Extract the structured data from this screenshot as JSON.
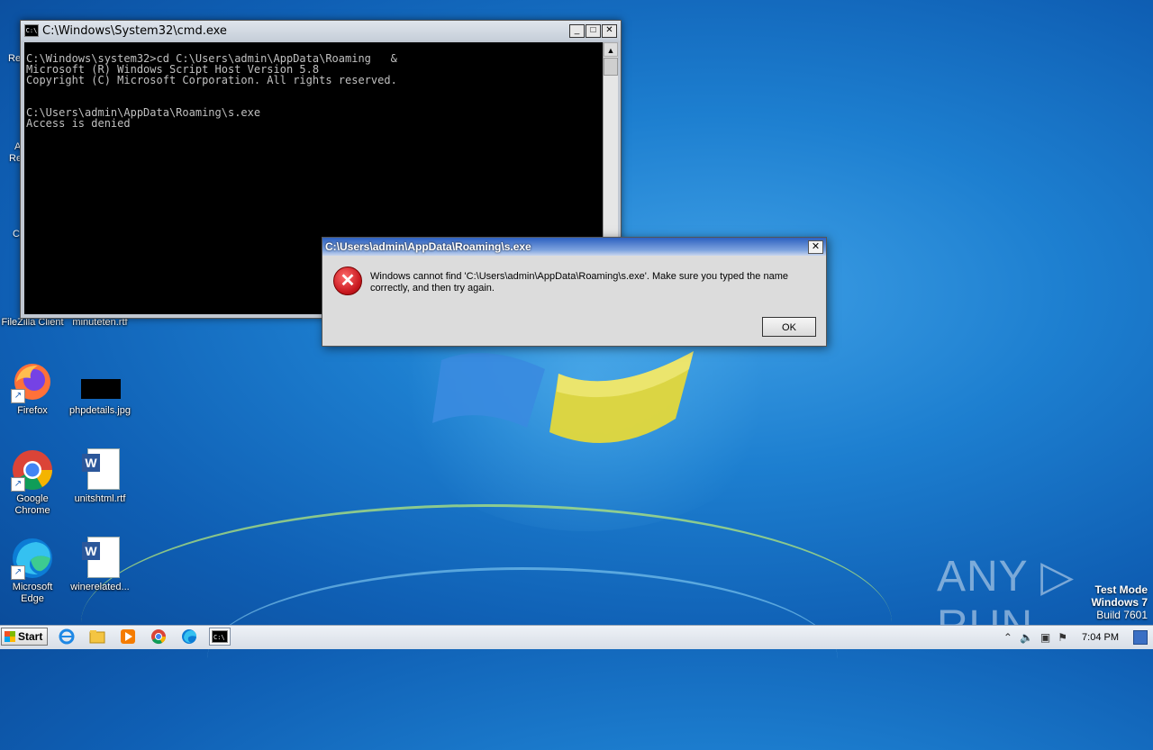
{
  "cmd_window": {
    "title": "C:\\Windows\\System32\\cmd.exe",
    "icon_label": "C:\\",
    "minimize": "_",
    "maximize": "□",
    "close": "✕",
    "console_text": "\nC:\\Windows\\system32>cd C:\\Users\\admin\\AppData\\Roaming   &\nMicrosoft (R) Windows Script Host Version 5.8\nCopyright (C) Microsoft Corporation. All rights reserved.\n\n\nC:\\Users\\admin\\AppData\\Roaming\\s.exe\nAccess is denied"
  },
  "error_dialog": {
    "title": "C:\\Users\\admin\\AppData\\Roaming\\s.exe",
    "close": "✕",
    "icon": "✕",
    "message": "Windows cannot find 'C:\\Users\\admin\\AppData\\Roaming\\s.exe'. Make sure you typed the name correctly, and then try again.",
    "ok_label": "OK"
  },
  "desktop_icons": {
    "filezilla": "FileZilla Client",
    "minuteten": "minuteten.rtf",
    "firefox": "Firefox",
    "phpdetails": "phpdetails.jpg",
    "chrome": "Google Chrome",
    "unitshtml": "unitshtml.rtf",
    "edge": "Microsoft Edge",
    "winerelated": "winerelated...",
    "partial_1": "Re",
    "partial_2": "A",
    "partial_3": "Re",
    "partial_4": "C"
  },
  "watermark": "ANY ▷ RUN",
  "test_mode": {
    "line1": "Test Mode",
    "line2": "Windows 7",
    "line3": "Build 7601"
  },
  "taskbar": {
    "start_label": "Start",
    "clock": "7:04 PM",
    "pinned": [
      "ie-icon",
      "explorer-icon",
      "media-player-icon",
      "chrome-icon",
      "edge-icon",
      "cmd-icon"
    ]
  }
}
